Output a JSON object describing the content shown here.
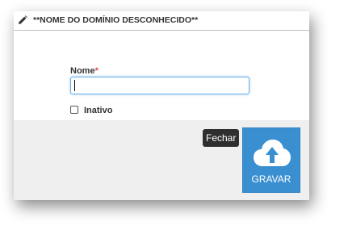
{
  "dialog": {
    "title": "**NOME DO DOMÍNIO DESCONHECIDO**"
  },
  "form": {
    "name_label": "Nome",
    "required_marker": "*",
    "name_value": "",
    "inactive_label": "Inativo",
    "inactive_checked": false
  },
  "actions": {
    "close_label": "Fechar",
    "save_label": "GRAVAR"
  },
  "colors": {
    "save_button": "#3a8fd0",
    "close_button": "#2f2f2f",
    "footer": "#efefef",
    "required": "#d9534f",
    "focus_border": "#66afe9"
  },
  "icons": {
    "header": "pencil-icon",
    "save": "cloud-upload-icon"
  }
}
